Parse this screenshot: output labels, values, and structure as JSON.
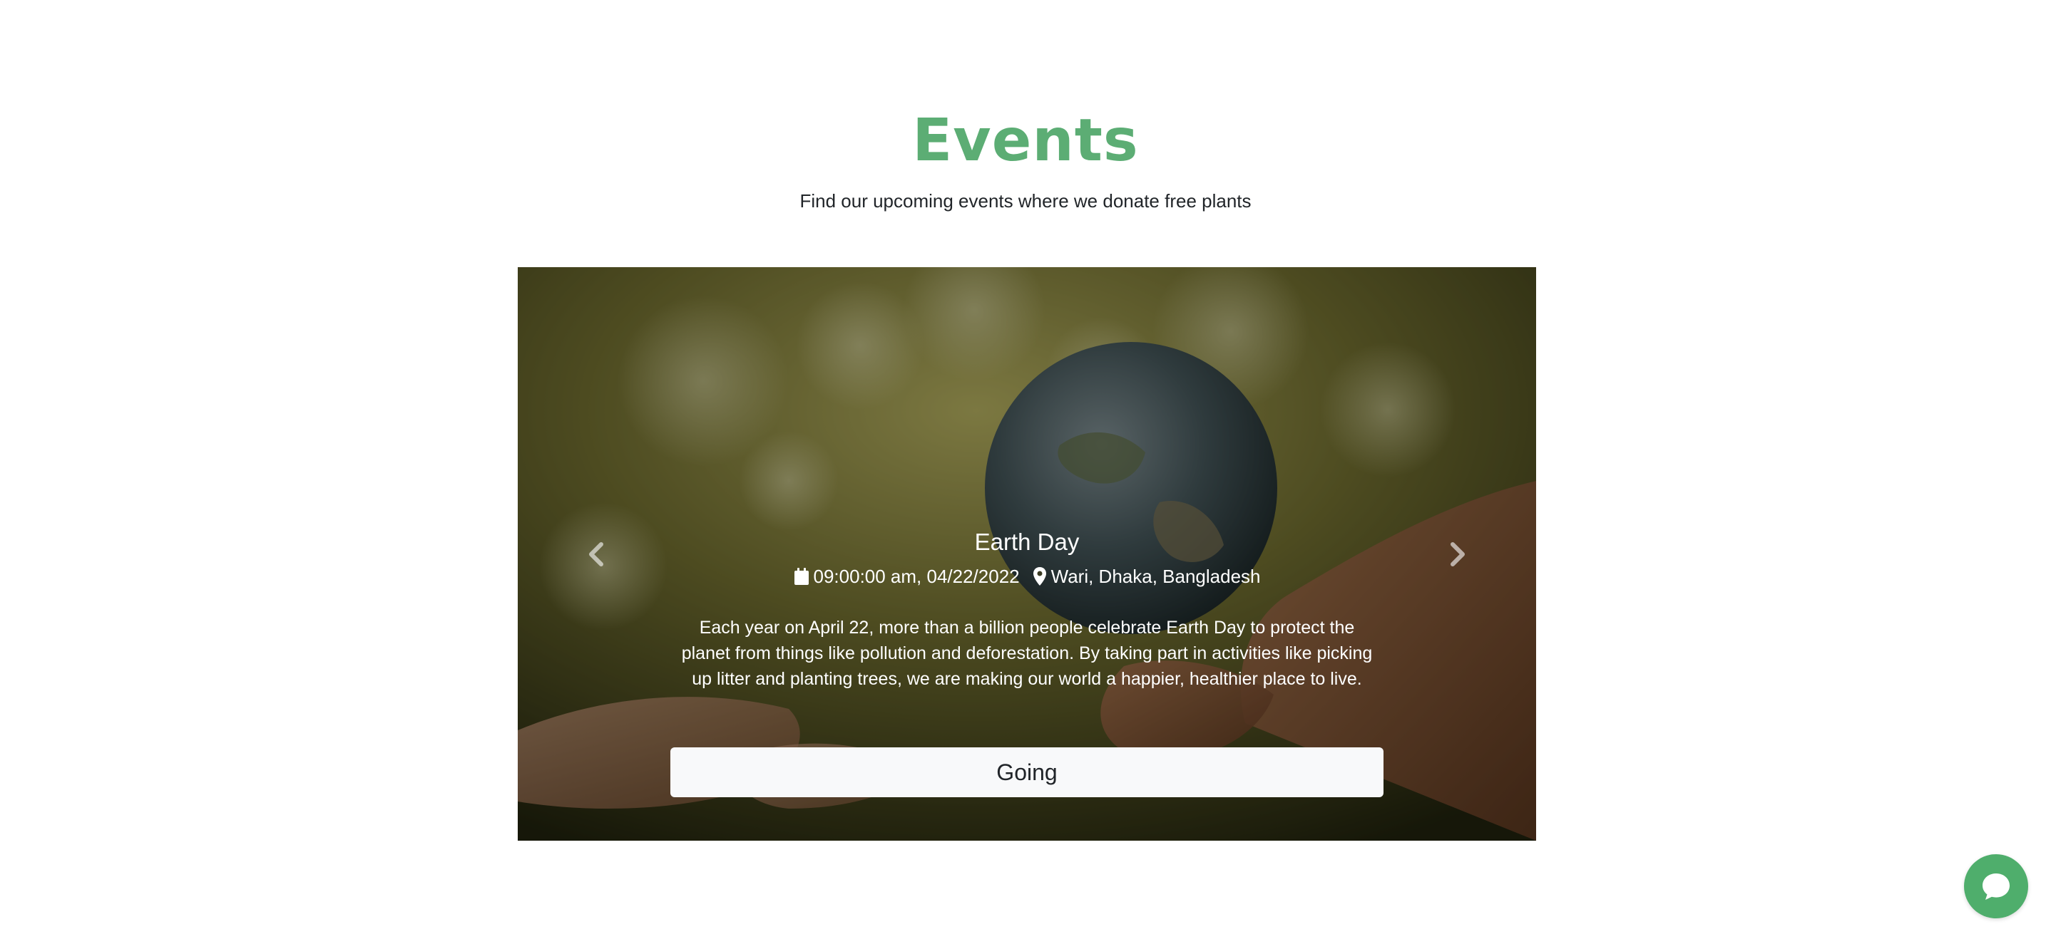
{
  "section": {
    "title": "Events",
    "subtitle": "Find our upcoming events where we donate free plants"
  },
  "carousel": {
    "slide": {
      "title": "Earth Day",
      "datetime": "09:00:00 am, 04/22/2022",
      "location": "Wari, Dhaka, Bangladesh",
      "description": "Each year on April 22, more than a billion people celebrate Earth Day to protect the planet from things like pollution and deforestation. By taking part in activities like picking up litter and planting trees, we are making our world a happier, healthier place to live.",
      "button_label": "Going"
    },
    "icons": {
      "date": "calendar-icon",
      "location": "map-marker-icon",
      "prev": "chevron-left-icon",
      "next": "chevron-right-icon"
    }
  },
  "chat": {
    "icon": "chat-bubble-icon"
  },
  "colors": {
    "accent": "#5cad74",
    "chat": "#4fae6c",
    "button_bg": "#f8f9fa"
  }
}
